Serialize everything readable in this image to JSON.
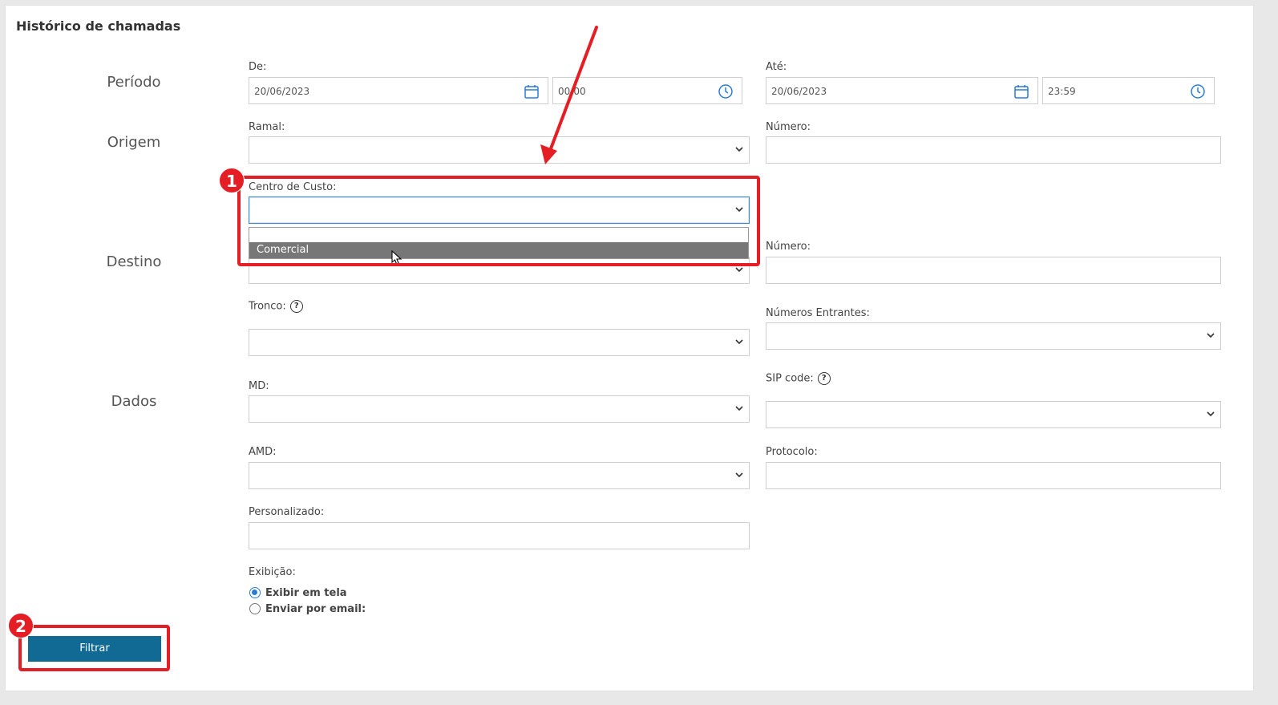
{
  "title": "Histórico de chamadas",
  "sections": {
    "periodo": "Período",
    "origem": "Origem",
    "destino": "Destino",
    "dados": "Dados"
  },
  "periodo": {
    "de_label": "De:",
    "de_date": "20/06/2023",
    "de_time": "00:00",
    "ate_label": "Até:",
    "ate_date": "20/06/2023",
    "ate_time": "23:59"
  },
  "origem": {
    "ramal_label": "Ramal:",
    "numero_label": "Número:",
    "centro_label": "Centro de Custo:"
  },
  "dropdown": {
    "options": [
      "",
      "Comercial"
    ],
    "highlighted": "Comercial"
  },
  "destino": {
    "numero_label": "Número:"
  },
  "dados": {
    "tronco_label": "Tronco:",
    "numeros_entrantes_label": "Números Entrantes:",
    "md_label": "MD:",
    "sip_label": "SIP code:",
    "amd_label": "AMD:",
    "protocolo_label": "Protocolo:",
    "personalizado_label": "Personalizado:",
    "help_glyph": "?"
  },
  "exibicao": {
    "label": "Exibição:",
    "options": [
      {
        "label": "Exibir em tela",
        "checked": true
      },
      {
        "label": "Enviar por email:",
        "checked": false
      }
    ]
  },
  "filter_button": "Filtrar",
  "annotations": {
    "badge1": "1",
    "badge2": "2",
    "color": "#e41e24"
  },
  "colors": {
    "button": "#106a94",
    "focus": "#3a86d6",
    "option_highlight": "#777777"
  }
}
